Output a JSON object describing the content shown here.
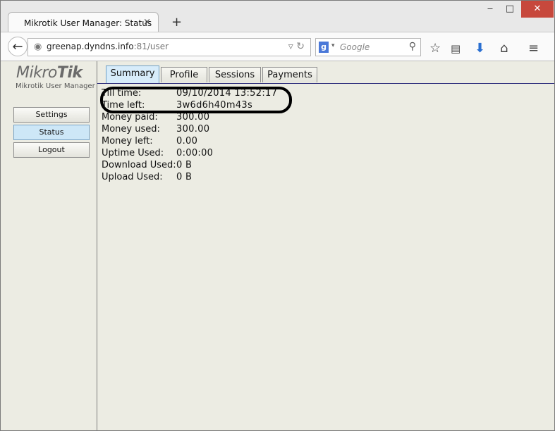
{
  "browser": {
    "tab_title": "Mikrotik User Manager: Status",
    "tab_close": "×",
    "new_tab": "+",
    "url_host": "greenap.dyndns.info",
    "url_rest": ":81/user",
    "search_placeholder": "Google",
    "window_controls": {
      "minimize": "‒",
      "maximize": "□",
      "close": "✕"
    },
    "icons": [
      "back-arrow-icon",
      "globe-icon",
      "dropdown-icon",
      "reload-icon",
      "google-icon",
      "search-icon",
      "star-icon",
      "reading-list-icon",
      "download-icon",
      "home-icon",
      "menu-icon"
    ]
  },
  "sidebar": {
    "logo_light": "Mikro",
    "logo_bold": "Tik",
    "logo_sub": "Mikrotik User Manager",
    "buttons": [
      {
        "label": "Settings",
        "active": false
      },
      {
        "label": "Status",
        "active": true
      },
      {
        "label": "Logout",
        "active": false
      }
    ]
  },
  "tabs": [
    {
      "label": "Summary",
      "active": true
    },
    {
      "label": "Profile",
      "active": false
    },
    {
      "label": "Sessions",
      "active": false
    },
    {
      "label": "Payments",
      "active": false
    }
  ],
  "summary": [
    {
      "label": "Till time:",
      "value": "09/10/2014 13:52:17"
    },
    {
      "label": "Time left:",
      "value": "3w6d6h40m43s"
    },
    {
      "label": "Money paid:",
      "value": "300.00"
    },
    {
      "label": "Money used:",
      "value": "300.00"
    },
    {
      "label": "Money left:",
      "value": "0.00"
    },
    {
      "label": "Uptime Used:",
      "value": "0:00:00"
    },
    {
      "label": "Download Used:",
      "value": "0 B"
    },
    {
      "label": "Upload Used:",
      "value": "0 B"
    }
  ],
  "colors": {
    "close_button": "#c7483c",
    "active_tab": "#d7ecfa",
    "content_bg": "#ecece3"
  }
}
